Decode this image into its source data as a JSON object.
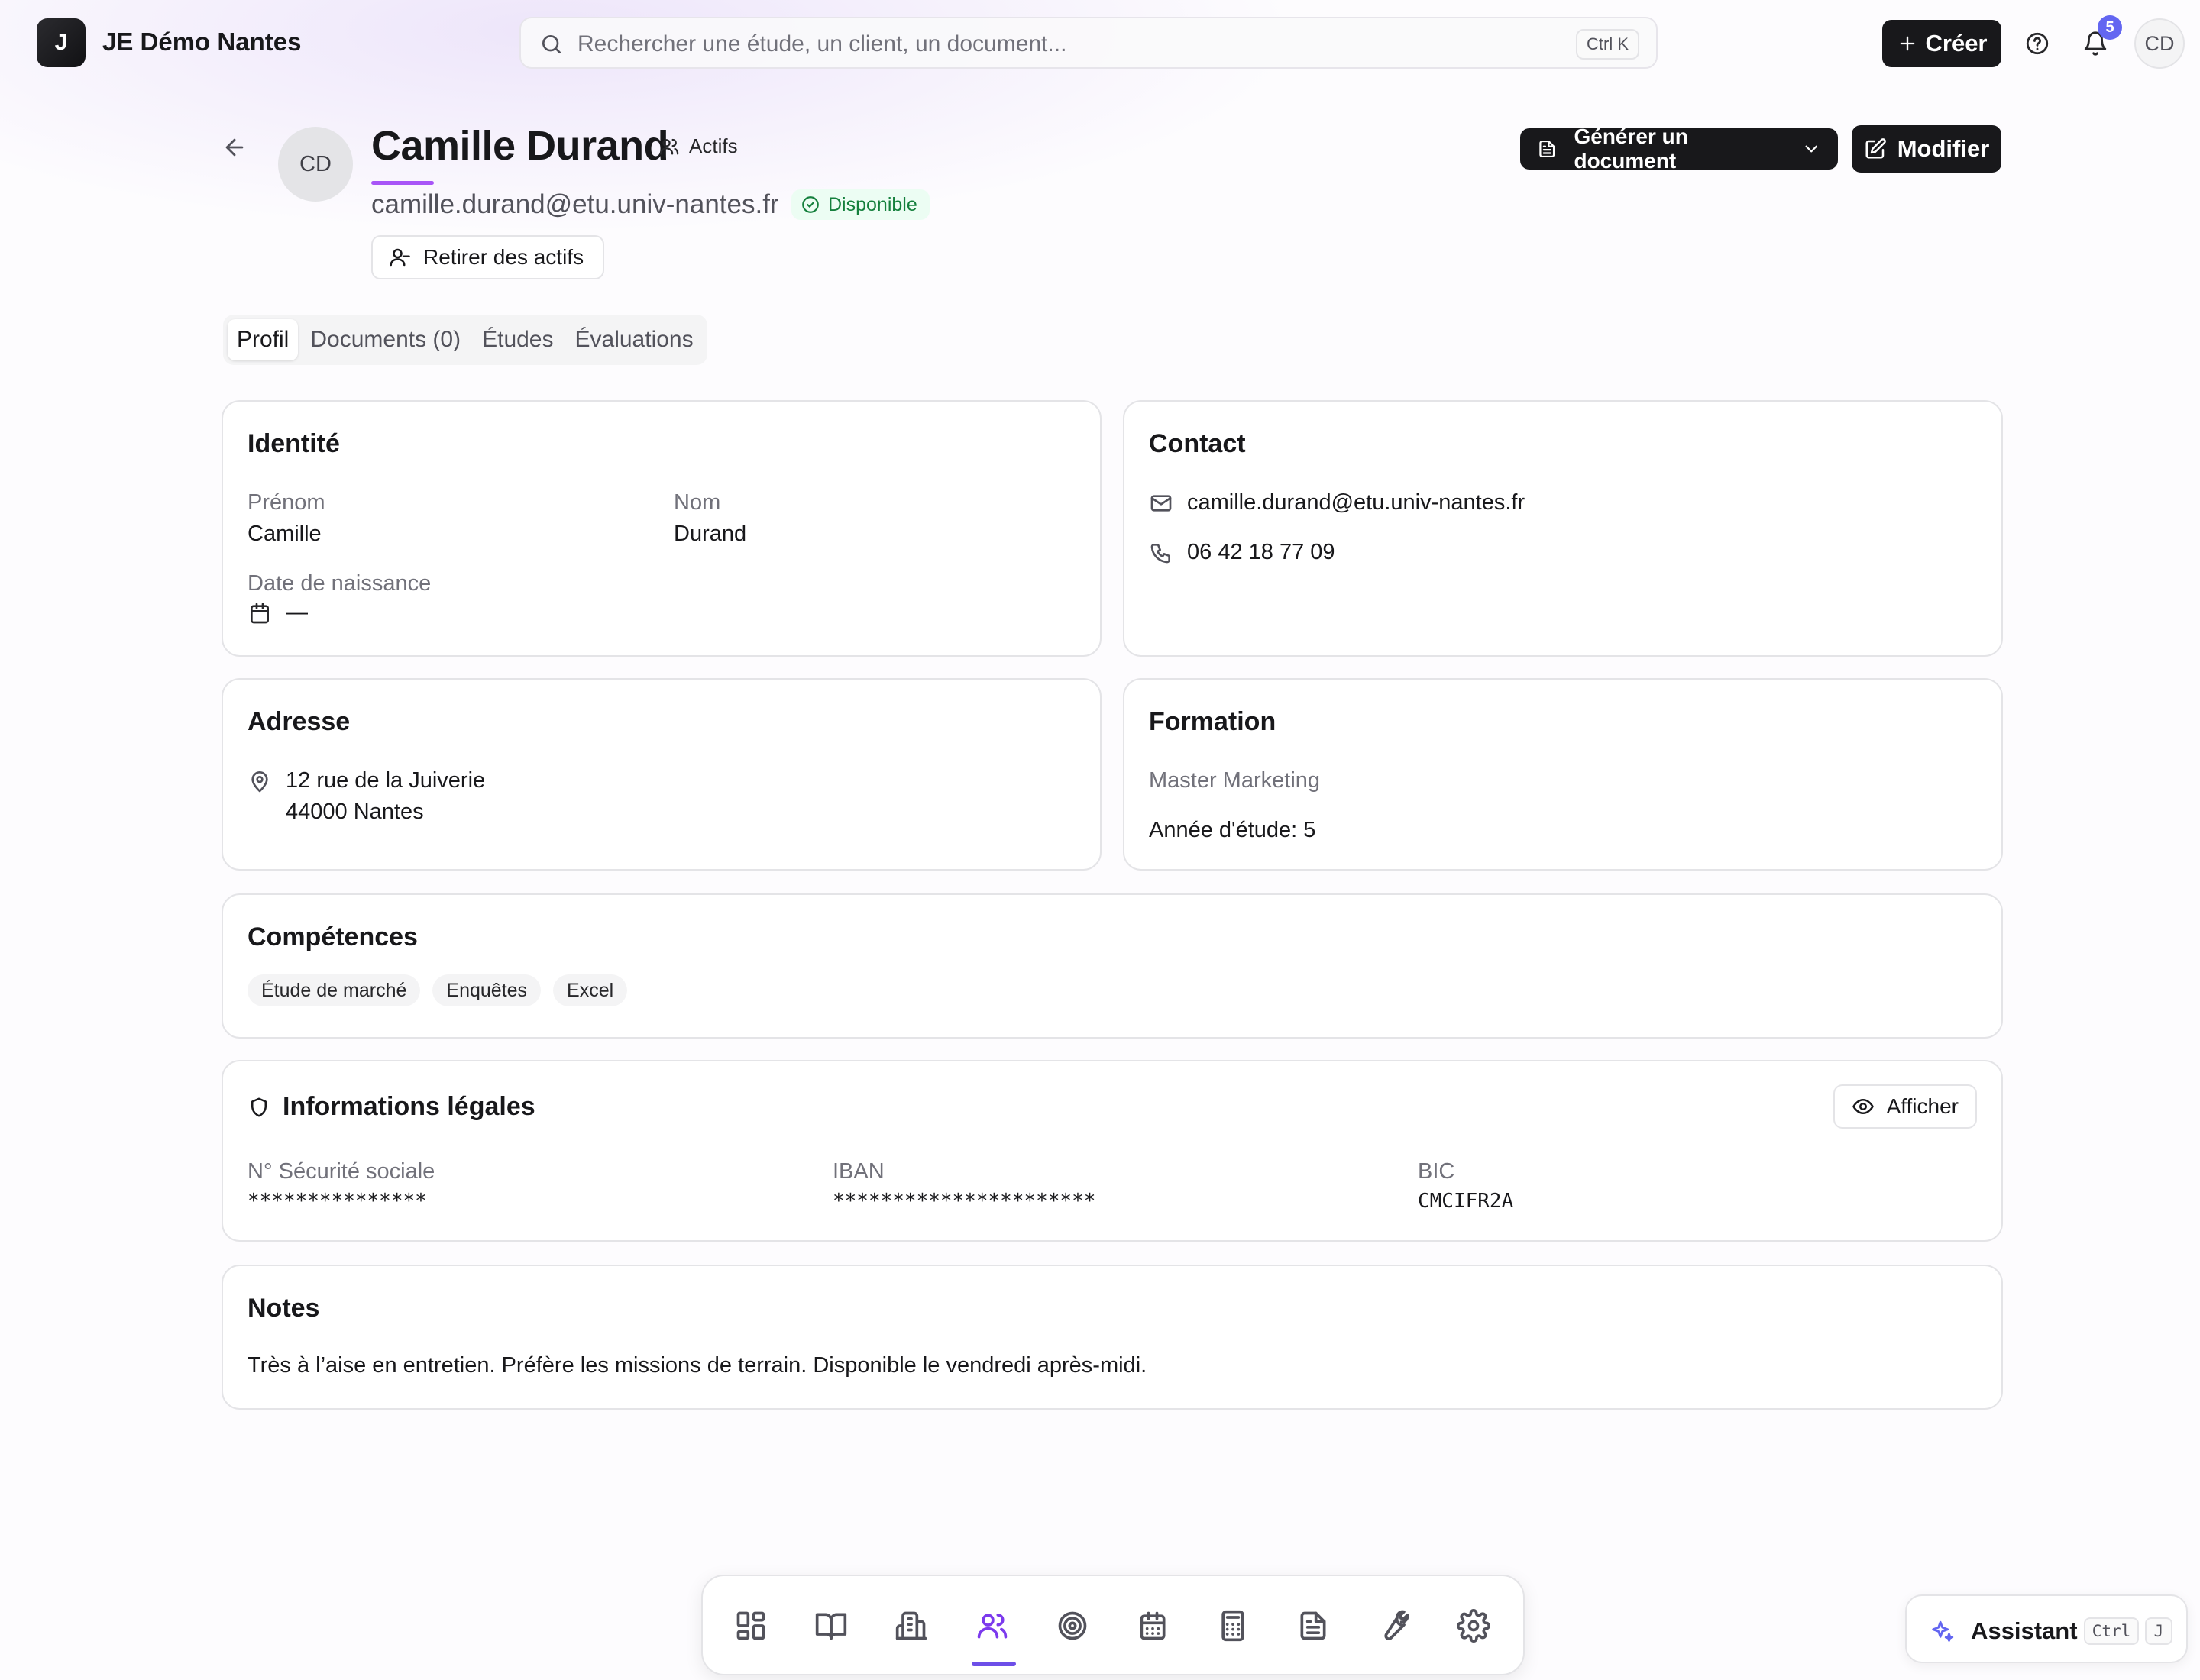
{
  "app": {
    "logo_letter": "J",
    "name": "JE Démo Nantes"
  },
  "search": {
    "placeholder": "Rechercher une étude, un client, un document...",
    "shortcut": "Ctrl K"
  },
  "topbar": {
    "create_label": "Créer",
    "notifications_count": "5",
    "user_initials": "CD"
  },
  "profile": {
    "initials": "CD",
    "name": "Camille Durand",
    "status_label": "Actifs",
    "email": "camille.durand@etu.univ-nantes.fr",
    "availability": "Disponible",
    "remove_label": "Retirer des actifs",
    "generate_label": "Générer un document",
    "modify_label": "Modifier"
  },
  "tabs": [
    {
      "label": "Profil",
      "active": true
    },
    {
      "label": "Documents (0)",
      "active": false
    },
    {
      "label": "Études",
      "active": false
    },
    {
      "label": "Évaluations",
      "active": false
    }
  ],
  "identity": {
    "title": "Identité",
    "first_name_label": "Prénom",
    "first_name": "Camille",
    "last_name_label": "Nom",
    "last_name": "Durand",
    "birth_label": "Date de naissance",
    "birth_value": "—"
  },
  "contact": {
    "title": "Contact",
    "email": "camille.durand@etu.univ-nantes.fr",
    "phone": "06 42 18 77 09"
  },
  "address": {
    "title": "Adresse",
    "line1": "12 rue de la Juiverie",
    "line2": "44000 Nantes"
  },
  "formation": {
    "title": "Formation",
    "program": "Master Marketing",
    "year": "Année d'étude: 5"
  },
  "skills": {
    "title": "Compétences",
    "items": [
      "Étude de marché",
      "Enquêtes",
      "Excel"
    ]
  },
  "legal": {
    "title": "Informations légales",
    "show_label": "Afficher",
    "ssn_label": "N° Sécurité sociale",
    "ssn_value": "***************",
    "iban_label": "IBAN",
    "iban_value": "**********************",
    "bic_label": "BIC",
    "bic_value": "CMCIFR2A"
  },
  "notes": {
    "title": "Notes",
    "text": "Très à l’aise en entretien. Préfère les missions de terrain. Disponible le vendredi après-midi."
  },
  "dock": {
    "items": [
      "dashboard-icon",
      "book-icon",
      "building-icon",
      "users-icon",
      "target-icon",
      "calendar-icon",
      "calculator-icon",
      "document-icon",
      "wrench-icon",
      "settings-icon"
    ],
    "active": "users-icon"
  },
  "assistant": {
    "label": "Assistant",
    "kbd1": "Ctrl",
    "kbd2": "J"
  },
  "colors": {
    "accent": "#7c3aed",
    "primary_button": "#18181b",
    "success": "#15803d",
    "badge": "#6366f1"
  }
}
